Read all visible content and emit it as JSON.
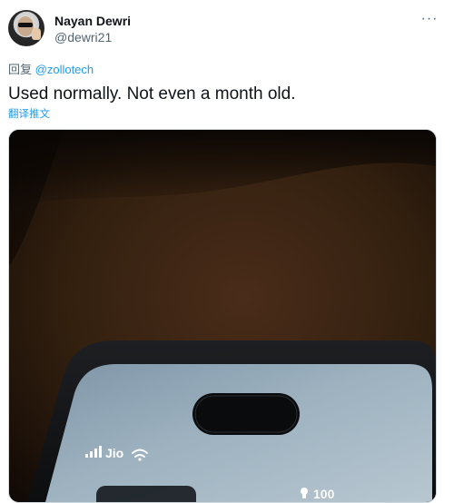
{
  "tweet": {
    "author_name": "Nayan Dewri",
    "author_handle": "@dewri21",
    "more_label": "···",
    "reply_prefix": "回复",
    "reply_mention": "@zollotech",
    "text": "Used normally. Not even a month old.",
    "translate_label": "翻译推文"
  },
  "photo": {
    "carrier": "Jio",
    "battery_partial": "100"
  },
  "colors": {
    "accent": "#1d9bf0",
    "secondary_text": "#536471",
    "primary_text": "#0f1419"
  }
}
